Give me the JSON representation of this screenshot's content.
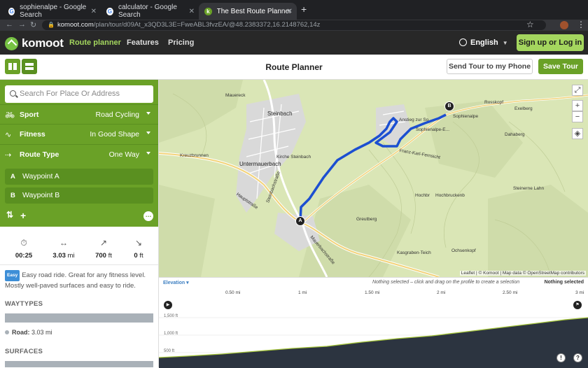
{
  "browser": {
    "tabs": [
      {
        "title": "sophienalpe - Google Search",
        "favicon": "G"
      },
      {
        "title": "calculator - Google Search",
        "favicon": "G"
      },
      {
        "title": "The Best Route Planner for Cyc",
        "favicon": "k"
      }
    ],
    "url_domain": "komoot.com",
    "url_path": "/plan/tour/d09At_x3QD3L3E=FweABL3fvzEA/@48.2383372,16.2148762,14z"
  },
  "nav": {
    "logo": "komoot",
    "links": [
      "Route planner",
      "Features",
      "Pricing"
    ],
    "language": "English",
    "signup": "Sign up or Log in"
  },
  "toolbar": {
    "title": "Route Planner",
    "send": "Send Tour to my Phone",
    "save": "Save Tour"
  },
  "planner": {
    "search_placeholder": "Search For Place Or Address",
    "sport": {
      "label": "Sport",
      "value": "Road Cycling"
    },
    "fitness": {
      "label": "Fitness",
      "value": "In Good Shape"
    },
    "route_type": {
      "label": "Route Type",
      "value": "One Way"
    },
    "waypoints": [
      {
        "letter": "A",
        "name": "Waypoint A"
      },
      {
        "letter": "B",
        "name": "Waypoint B"
      }
    ]
  },
  "stats": {
    "duration": "00:25",
    "distance_value": "3.03",
    "distance_unit": "mi",
    "uphill_value": "700",
    "uphill_unit": "ft",
    "downhill_value": "0",
    "downhill_unit": "ft"
  },
  "description": {
    "badge": "Easy",
    "text": "Easy road ride. Great for any fitness level. Mostly well-paved surfaces and easy to ride."
  },
  "waytypes": {
    "heading": "WAYTYPES",
    "legend": "Road:",
    "legend_value": "3.03 mi"
  },
  "surfaces": {
    "heading": "SURFACES"
  },
  "map": {
    "labels": [
      "Steinbach",
      "Untermauerbach",
      "Kreuzbrunnen",
      "Kirche Steinbach",
      "Mauereck",
      "Hauptstraße",
      "Steinbachstraße",
      "Mauerbachstraße",
      "Anstieg zur So",
      "Sophienalpe-E...",
      "Sophienalpe",
      "Franz-Karl-Fernsicht",
      "Hochbruckenb",
      "Hochbr",
      "Greutberg",
      "Kasgraben-Teich",
      "Ochsenkopf",
      "Rosskopf",
      "Exelberg",
      "Dahaberg",
      "Steinerne Lahn"
    ],
    "attribution": "Leaflet | © Komoot | Map data © OpenStreetMap contributors",
    "pin_a": "A",
    "pin_b": "B"
  },
  "elevation": {
    "label": "Elevation",
    "nothing_selected_hint": "Nothing selected – click and drag on the profile to create a selection",
    "nothing_selected": "Nothing selected",
    "x_ticks": [
      "0.50 mi",
      "1 mi",
      "1.50 mi",
      "2 mi",
      "2.50 mi",
      "3 mi"
    ],
    "y_ticks": [
      "1,500 ft",
      "1,000 ft",
      "500 ft"
    ]
  },
  "colors": {
    "brand_green": "#6aa127",
    "route_blue": "#1c4fd1",
    "accent_lime": "#a4d65e"
  }
}
